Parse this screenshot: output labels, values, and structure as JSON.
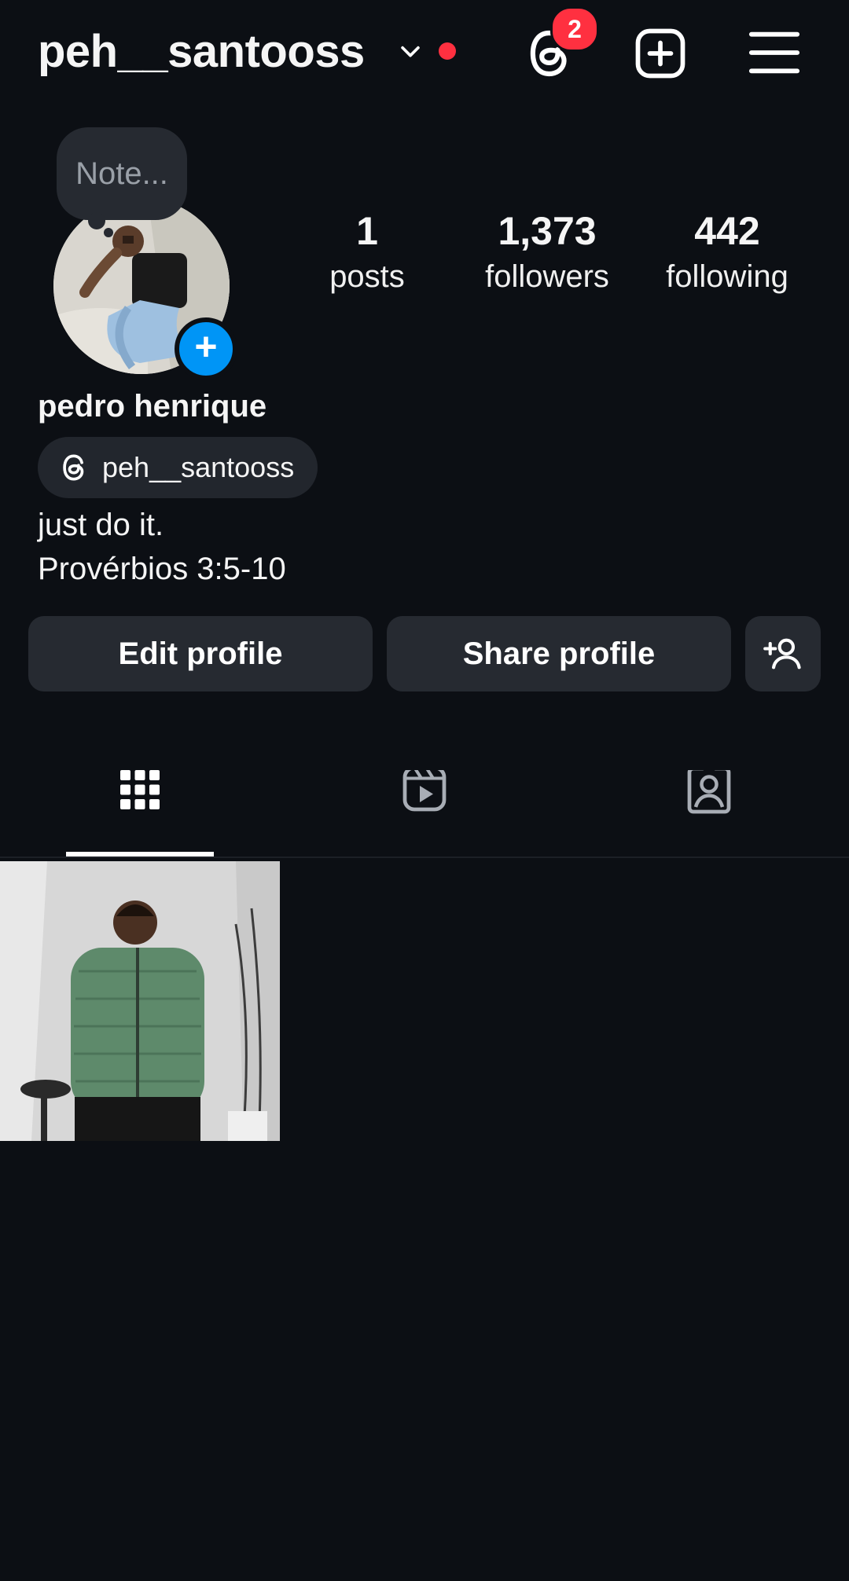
{
  "header": {
    "username": "peh__santooss",
    "threads_badge_count": "2"
  },
  "note": {
    "placeholder": "Note..."
  },
  "stats": [
    {
      "value": "1",
      "label": "posts"
    },
    {
      "value": "1,373",
      "label": "followers"
    },
    {
      "value": "442",
      "label": "following"
    }
  ],
  "profile": {
    "full_name": "pedro henrique",
    "threads_handle": "peh__santooss",
    "bio_lines": [
      "just do it.",
      "Provérbios 3:5-10"
    ]
  },
  "actions": {
    "edit_label": "Edit profile",
    "share_label": "Share profile"
  },
  "tabs": [
    {
      "icon": "grid-icon",
      "selected": true
    },
    {
      "icon": "reels-icon",
      "selected": false
    },
    {
      "icon": "tagged-icon",
      "selected": false
    }
  ],
  "colors": {
    "background": "#0c0f14",
    "accent_blue": "#0095f6",
    "notification_red": "#ff3040",
    "button_bg": "#262a31"
  }
}
